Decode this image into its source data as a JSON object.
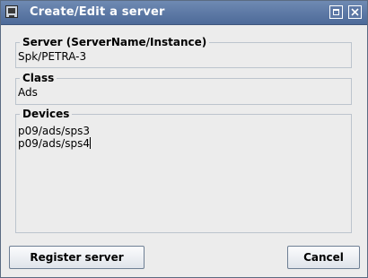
{
  "window": {
    "title": "Create/Edit a server",
    "icons": {
      "app": "computer-monitor-icon",
      "maximize": "maximize-icon",
      "close": "close-icon"
    }
  },
  "form": {
    "server": {
      "legend": "Server  (ServerName/Instance)",
      "value": "Spk/PETRA-3"
    },
    "class": {
      "legend": "Class",
      "value": "Ads"
    },
    "devices": {
      "legend": "Devices",
      "lines": [
        "p09/ads/sps3",
        "p09/ads/sps4"
      ]
    }
  },
  "buttons": {
    "register": "Register server",
    "cancel": "Cancel"
  },
  "colors": {
    "titlebar": "#5b77a6",
    "background": "#ececec",
    "border": "#bcc4cd"
  }
}
